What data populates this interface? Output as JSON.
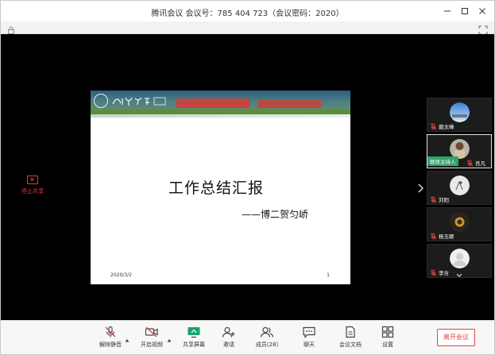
{
  "window": {
    "title": "腾讯会议 会议号：785 404 723（会议密码：2020）"
  },
  "share": {
    "stop_label": "停止共享"
  },
  "slide": {
    "title": "工作总结汇报",
    "subtitle": "——博二贺匀峤",
    "date": "2020/3/2",
    "page_number": "1"
  },
  "participants": [
    {
      "name": "聂文峰",
      "muted": true,
      "host": false
    },
    {
      "name": "肖凡",
      "muted": true,
      "host": true,
      "host_label": "联席主持人"
    },
    {
      "name": "刘阳",
      "muted": true,
      "host": false
    },
    {
      "name": "杨玉卿",
      "muted": true,
      "host": false
    },
    {
      "name": "李含",
      "muted": true,
      "host": false
    }
  ],
  "toolbar": {
    "unmute": "解除静音",
    "video": "开启视频",
    "share": "共享屏幕",
    "invite": "邀请",
    "members": "成员(28)",
    "chat": "聊天",
    "docs": "会议文档",
    "settings": "设置",
    "leave": "离开会议"
  },
  "colors": {
    "accent_red": "#e04545",
    "host_green": "#2fa36b",
    "share_green": "#1aa36a",
    "stage_bg": "#000000"
  }
}
